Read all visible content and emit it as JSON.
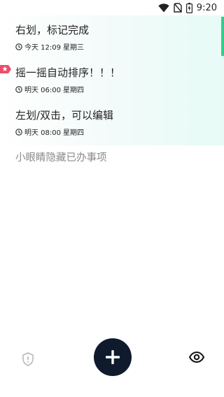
{
  "status_bar": {
    "time": "9:20",
    "icons": [
      "wifi-icon",
      "no-sim-icon",
      "battery-charging-icon"
    ]
  },
  "tasks": [
    {
      "title": "右划，标记完成",
      "time": "今天 12:09",
      "weekday": "星期三",
      "starred": false
    },
    {
      "title": "摇一摇自动排序！！！",
      "time": "明天 06:00",
      "weekday": "星期四",
      "starred": true
    },
    {
      "title": "左划/双击，可以编辑",
      "time": "明天 08:00",
      "weekday": "星期四",
      "starred": false
    }
  ],
  "hint_text": "小眼睛隐藏已办事项",
  "colors": {
    "accent_green": "#2fcf8a",
    "star_badge": "#f04a6a",
    "fab_background": "#0f1b2d",
    "hint_text": "#8a8a8a"
  },
  "bottom_bar": {
    "left_icon": "shield-alert-icon",
    "center_icon": "plus-icon",
    "right_icon": "eye-icon"
  }
}
